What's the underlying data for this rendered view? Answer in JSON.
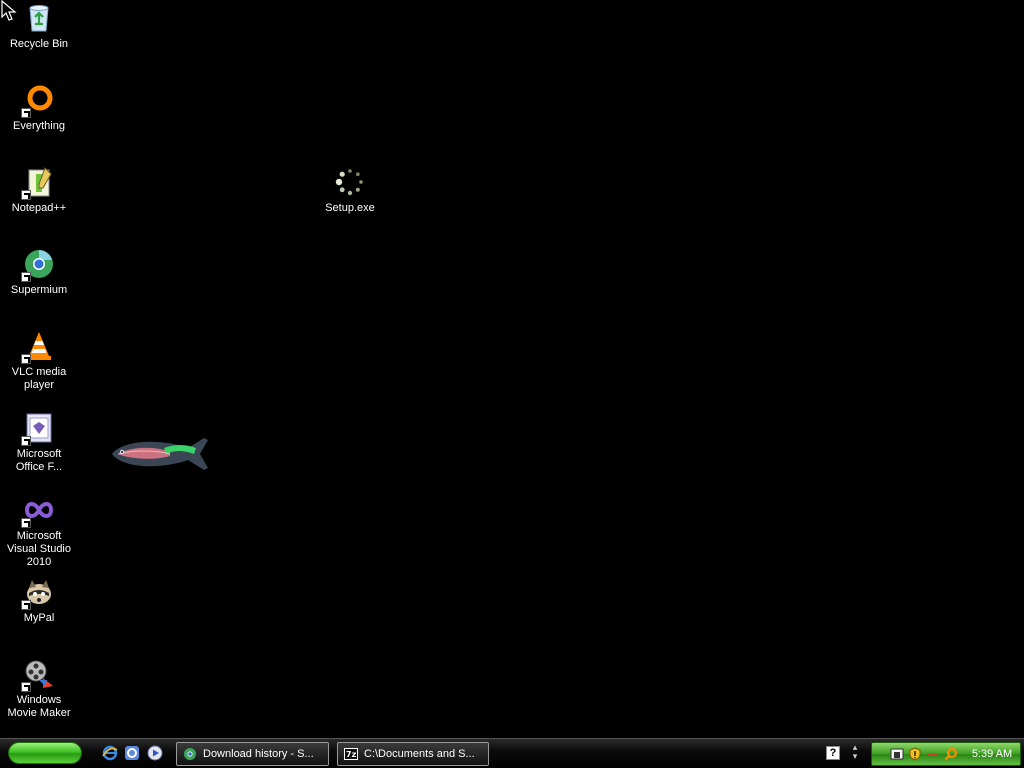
{
  "desktop": {
    "background_color": "#000000",
    "icons": [
      {
        "label": "Recycle Bin",
        "icon": "recycle-bin-icon",
        "shortcut": false
      },
      {
        "label": "Everything",
        "icon": "everything-search-icon",
        "shortcut": true
      },
      {
        "label": "Notepad++",
        "icon": "notepad-plus-plus-icon",
        "shortcut": true
      },
      {
        "label": "Supermium",
        "icon": "supermium-browser-icon",
        "shortcut": true
      },
      {
        "label": "VLC media player",
        "icon": "vlc-cone-icon",
        "shortcut": true
      },
      {
        "label": "Microsoft Office F...",
        "icon": "office-file-icon",
        "shortcut": true
      },
      {
        "label": "Microsoft Visual Studio 2010",
        "icon": "visual-studio-icon",
        "shortcut": true
      },
      {
        "label": "MyPal",
        "icon": "mypal-raccoon-icon",
        "shortcut": true
      },
      {
        "label": "Windows Movie Maker",
        "icon": "movie-maker-icon",
        "shortcut": true
      },
      {
        "label": "Setup.exe",
        "icon": "loading-spinner-icon",
        "shortcut": false
      }
    ]
  },
  "taskbar": {
    "quick_launch": [
      "internet-explorer-icon",
      "ie-alt-icon",
      "media-player-icon"
    ],
    "tasks": [
      {
        "label": "Download history - S...",
        "icon": "supermium-browser-icon"
      },
      {
        "label": "C:\\Documents and S...",
        "icon": "7zip-icon"
      }
    ],
    "tray": {
      "icons": [
        "network-icon",
        "security-shield-icon",
        "minus-icon",
        "search-icon"
      ],
      "clock": "5:39 AM"
    },
    "accent": "#3fbf25"
  }
}
